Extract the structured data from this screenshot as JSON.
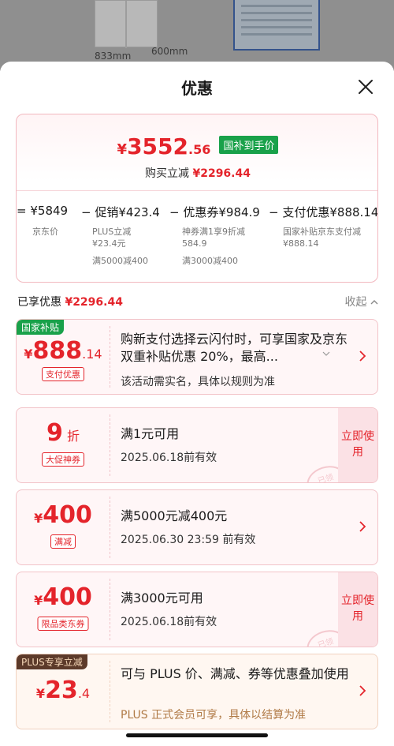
{
  "background": {
    "dim_width": "833mm",
    "dim_depth": "600mm"
  },
  "sheet": {
    "title": "优惠",
    "close_icon": "close-icon"
  },
  "summary": {
    "price_yen": "¥",
    "price_int": "3552",
    "price_dec": ".56",
    "badge": "国补到手价",
    "saved_label": "购买立减",
    "saved_amount": "¥2296.44",
    "formula": [
      {
        "op": "=",
        "amount": "¥5849",
        "label": "京东价",
        "subs": []
      },
      {
        "op": "−",
        "amount": "促销¥423.4",
        "label": "PLUS立减",
        "subs": [
          "¥23.4元",
          "满5000减400"
        ]
      },
      {
        "op": "−",
        "amount": "优惠券¥984.9",
        "label": "神券满1享9折减",
        "subs": [
          "584.9",
          "满3000减400"
        ]
      },
      {
        "op": "−",
        "amount": "支付优惠¥888.14",
        "label": "国家补贴京东支付减",
        "subs": [
          "¥888.14"
        ]
      }
    ]
  },
  "section": {
    "label": "已享优惠",
    "amount": "¥2296.44",
    "collapse": "收起"
  },
  "cards": [
    {
      "corner": "国家补贴",
      "yen": "¥",
      "big": "888",
      "dec": ".14",
      "tag": "支付优惠",
      "title": "购新支付选择云闪付时，可享国家及京东双重补贴优惠 20%，最高...",
      "sub": "该活动需实名，具体以规则为准",
      "action": "chevron"
    },
    {
      "big": "9",
      "dec": "折",
      "tag": "大促神券",
      "title": "满1元可用",
      "sub": "2025.06.18前有效",
      "action": "立即使用",
      "stamp": "已领"
    },
    {
      "yen": "¥",
      "big": "400",
      "tag": "满减",
      "title": "满5000元减400元",
      "sub": "2025.06.30 23:59 前有效",
      "action": "chevron"
    },
    {
      "yen": "¥",
      "big": "400",
      "tag": "限品类东券",
      "title": "满3000元可用",
      "sub": "2025.06.18前有效",
      "action": "立即使用",
      "stamp": "已领"
    },
    {
      "corner": "PLUS专享立减",
      "yen": "¥",
      "big": "23",
      "dec": ".4",
      "title": "可与 PLUS 价、满减、券等优惠叠加使用",
      "sub": "PLUS 正式会员可享，具体以结算为准",
      "action": "chevron"
    }
  ],
  "colors": {
    "accent_red": "#e4242b",
    "green_badge": "#19a14a",
    "plus_brown": "#5c3a2a"
  }
}
